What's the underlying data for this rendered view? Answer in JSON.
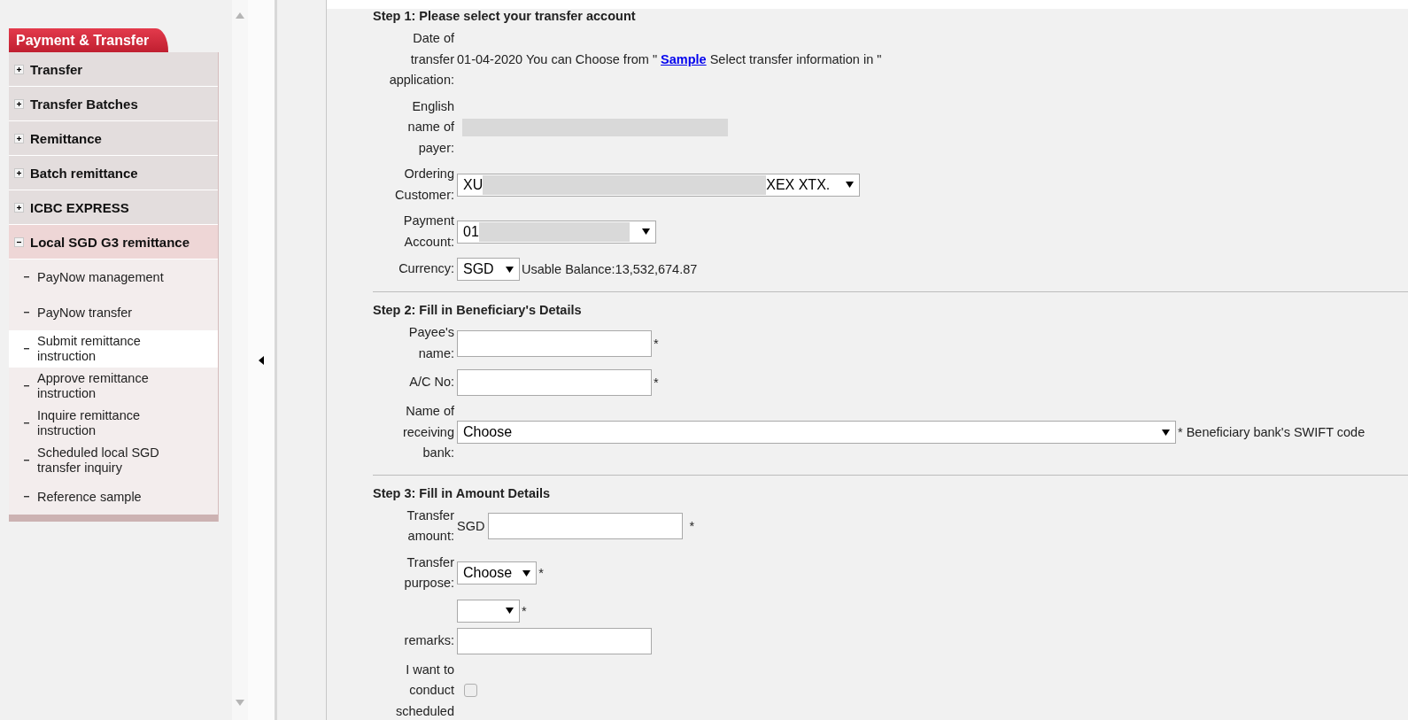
{
  "sidebar": {
    "title": "Payment & Transfer",
    "items": [
      {
        "label": "Transfer",
        "expanded": false
      },
      {
        "label": "Transfer Batches",
        "expanded": false
      },
      {
        "label": "Remittance",
        "expanded": false
      },
      {
        "label": "Batch remittance",
        "expanded": false
      },
      {
        "label": "ICBC EXPRESS",
        "expanded": false
      },
      {
        "label": "Local SGD G3 remittance",
        "expanded": true,
        "children": [
          {
            "label": "PayNow management",
            "selected": false
          },
          {
            "label": "PayNow transfer",
            "selected": false
          },
          {
            "label": "Submit remittance instruction",
            "selected": true
          },
          {
            "label": "Approve remittance instruction",
            "selected": false
          },
          {
            "label": "Inquire remittance instruction",
            "selected": false
          },
          {
            "label": "Scheduled local SGD transfer inquiry",
            "selected": false
          },
          {
            "label": "Reference sample",
            "selected": false
          }
        ]
      }
    ]
  },
  "form": {
    "steps": [
      {
        "title": "Step 1: Please select your transfer account",
        "rows": [
          {
            "kind": "info",
            "label": "Date of transfer application:",
            "text": "01-04-2020 You can Choose from \"",
            "link": "Sample",
            "after": "Select transfer information in \""
          },
          {
            "kind": "redacted",
            "label": "English name of payer:"
          },
          {
            "kind": "select",
            "label": "Ordering Customer:",
            "value": "XU",
            "value_end": "XEX XTX.",
            "redacted": true
          },
          {
            "kind": "select",
            "label": "Payment Account:",
            "value": "01",
            "redacted": true
          },
          {
            "kind": "select",
            "label": "Currency:",
            "value": "SGD",
            "suffix": "Usable Balance:13,532,674.87"
          }
        ]
      },
      {
        "title": "Step 2: Fill in Beneficiary's Details",
        "rows": [
          {
            "kind": "input",
            "label": "Payee's name:",
            "suffix": "*"
          },
          {
            "kind": "input",
            "label": "A/C No:",
            "suffix": "*"
          },
          {
            "kind": "select",
            "label": "Name of receiving bank:",
            "value": "Choose",
            "suffix": "* Beneficiary bank's SWIFT code"
          }
        ]
      },
      {
        "title": "Step 3: Fill in Amount Details",
        "rows": [
          {
            "kind": "input",
            "label": "Transfer amount:",
            "prefix": "SGD",
            "suffix": "*"
          },
          {
            "kind": "select",
            "label": "Transfer purpose:",
            "value": "Choose",
            "suffix": "*"
          },
          {
            "kind": "select",
            "suffix": "*"
          },
          {
            "kind": "input",
            "label": "remarks:"
          },
          {
            "kind": "checkbox",
            "label": "I want to conduct scheduled",
            "checked": false
          }
        ]
      }
    ]
  }
}
